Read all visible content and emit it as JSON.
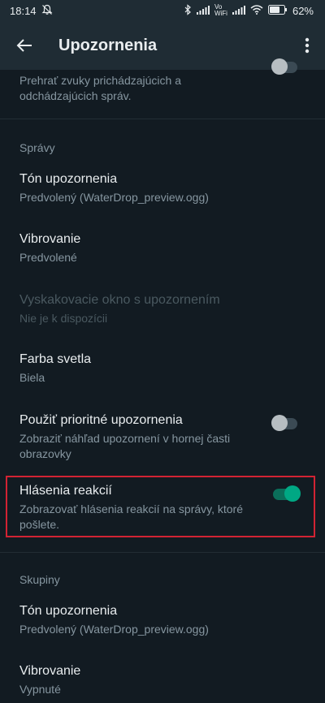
{
  "status_bar": {
    "time": "18:14",
    "vowifi_top": "Vo",
    "vowifi_bottom": "WiFi",
    "battery": "62%"
  },
  "app_bar": {
    "title": "Upozornenia"
  },
  "items": {
    "sounds_subtitle": "Prehrať zvuky prichádzajúcich a odchádzajúcich správ.",
    "messages_header": "Správy",
    "tone": {
      "title": "Tón upozornenia",
      "subtitle": "Predvolený (WaterDrop_preview.ogg)"
    },
    "vibrate": {
      "title": "Vibrovanie",
      "subtitle": "Predvolené"
    },
    "popup": {
      "title": "Vyskakovacie okno s upozornením",
      "subtitle": "Nie je k dispozícii"
    },
    "light": {
      "title": "Farba svetla",
      "subtitle": "Biela"
    },
    "priority": {
      "title": "Použiť prioritné upozornenia",
      "subtitle": "Zobraziť náhľad upozornení v hornej časti obrazovky"
    },
    "reactions": {
      "title": "Hlásenia reakcií",
      "subtitle": "Zobrazovať hlásenia reakcií na správy, ktoré pošlete."
    },
    "groups_header": "Skupiny",
    "group_tone": {
      "title": "Tón upozornenia",
      "subtitle": "Predvolený (WaterDrop_preview.ogg)"
    },
    "group_vibrate": {
      "title": "Vibrovanie",
      "subtitle": "Vypnuté"
    }
  },
  "toggles": {
    "sounds": "off",
    "priority": "off",
    "reactions": "on"
  },
  "colors": {
    "background": "#121b22",
    "toolbar": "#1f2c34",
    "accent": "#00a884",
    "highlight_border": "#d22333"
  }
}
